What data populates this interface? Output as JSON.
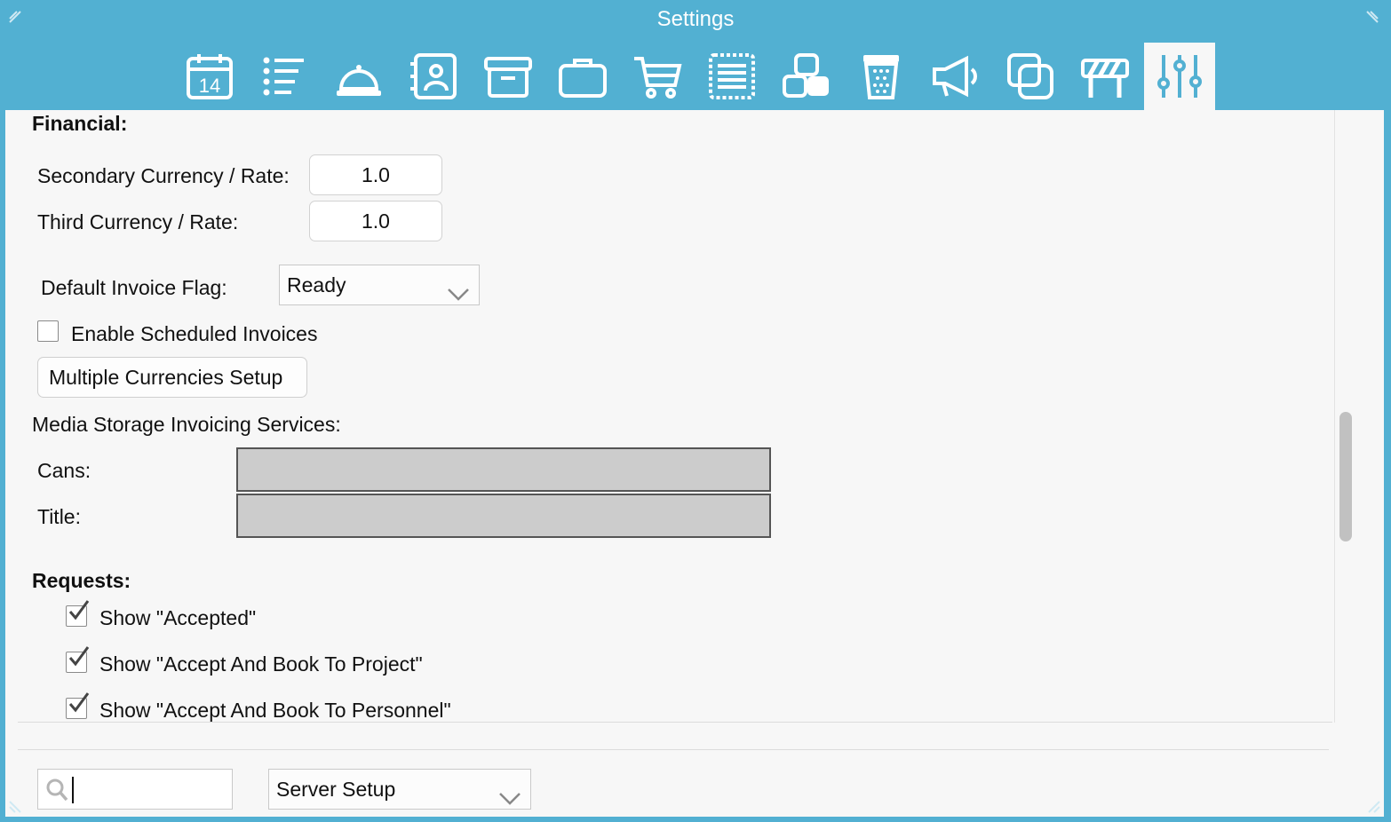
{
  "window": {
    "title": "Settings"
  },
  "toolbar": {
    "items": [
      {
        "icon": "calendar-icon",
        "number": "14"
      },
      {
        "icon": "list-icon"
      },
      {
        "icon": "service-bell-icon"
      },
      {
        "icon": "contact-book-icon"
      },
      {
        "icon": "archive-box-icon"
      },
      {
        "icon": "briefcase-icon"
      },
      {
        "icon": "shopping-cart-icon"
      },
      {
        "icon": "document-list-icon"
      },
      {
        "icon": "blocks-icon"
      },
      {
        "icon": "trash-icon"
      },
      {
        "icon": "megaphone-icon"
      },
      {
        "icon": "overlap-squares-icon"
      },
      {
        "icon": "barrier-icon"
      },
      {
        "icon": "sliders-icon",
        "active": true
      }
    ],
    "accent_color": "#52b0d2"
  },
  "financial": {
    "heading": "Financial:",
    "secondary_currency_label": "Secondary Currency / Rate:",
    "secondary_currency_value": "1.0",
    "third_currency_label": "Third Currency / Rate:",
    "third_currency_value": "1.0",
    "invoice_flag_label": "Default Invoice Flag:",
    "invoice_flag_value": "Ready",
    "scheduled_invoices_label": "Enable Scheduled Invoices",
    "scheduled_invoices_checked": false,
    "multiple_currencies_button": "Multiple Currencies Setup"
  },
  "media_storage": {
    "heading": "Media Storage Invoicing Services:",
    "cans_label": "Cans:",
    "title_label": "Title:"
  },
  "requests": {
    "heading": "Requests:",
    "options": [
      {
        "label": "Show \"Accepted\"",
        "checked": true
      },
      {
        "label": "Show \"Accept And Book To Project\"",
        "checked": true
      },
      {
        "label": "Show \"Accept And Book To Personnel\"",
        "checked": true
      }
    ]
  },
  "footer": {
    "search_value": "",
    "section_select_value": "Server Setup"
  }
}
